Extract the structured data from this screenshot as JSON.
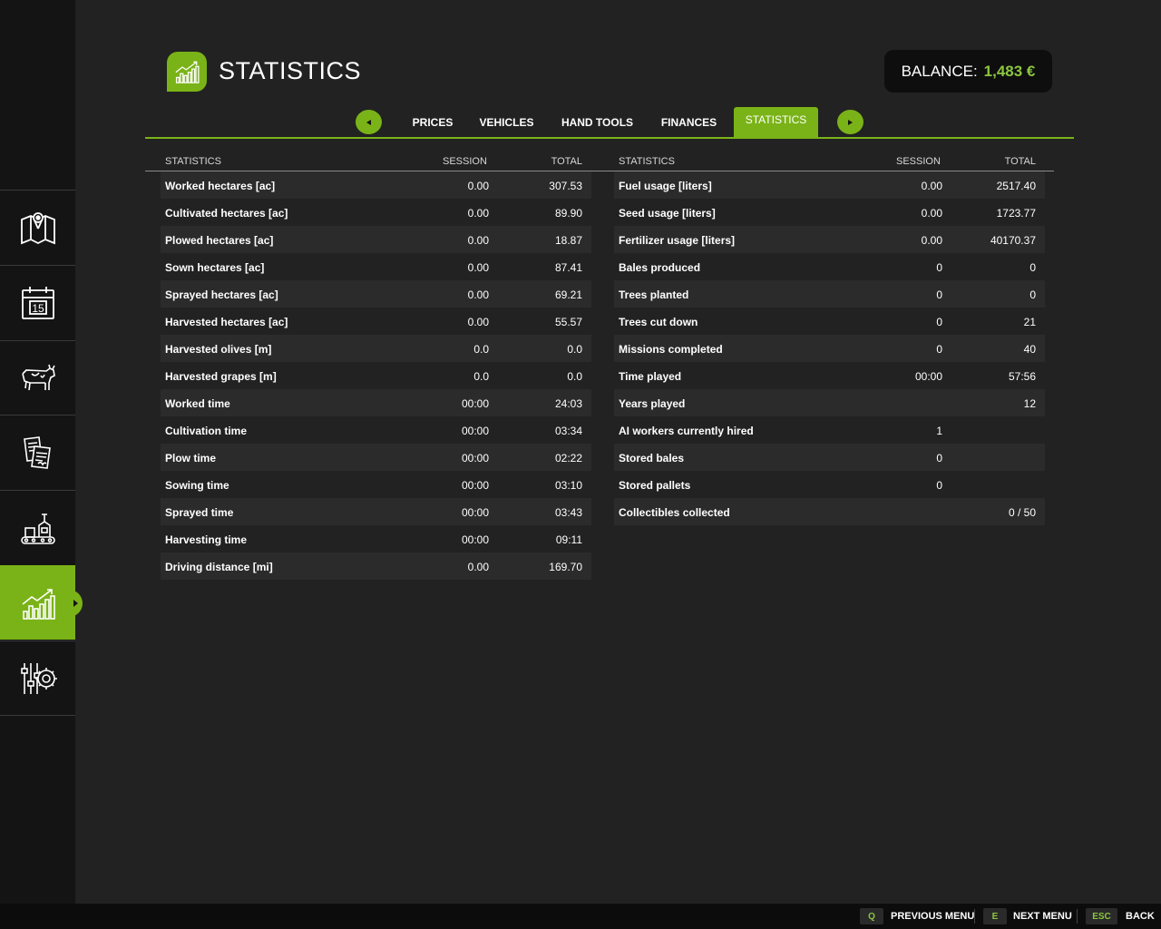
{
  "header": {
    "title": "STATISTICS",
    "balance_label": "BALANCE:",
    "balance_value": "1,483 €"
  },
  "tabs": [
    {
      "label": "PRICES"
    },
    {
      "label": "VEHICLES"
    },
    {
      "label": "HAND TOOLS"
    },
    {
      "label": "FINANCES"
    },
    {
      "label": "STATISTICS",
      "active": true
    }
  ],
  "left_table": {
    "headers": {
      "name": "STATISTICS",
      "session": "SESSION",
      "total": "TOTAL"
    },
    "rows": [
      {
        "name": "Worked hectares [ac]",
        "session": "0.00",
        "total": "307.53"
      },
      {
        "name": "Cultivated hectares [ac]",
        "session": "0.00",
        "total": "89.90"
      },
      {
        "name": "Plowed hectares [ac]",
        "session": "0.00",
        "total": "18.87"
      },
      {
        "name": "Sown hectares [ac]",
        "session": "0.00",
        "total": "87.41"
      },
      {
        "name": "Sprayed hectares [ac]",
        "session": "0.00",
        "total": "69.21"
      },
      {
        "name": "Harvested hectares [ac]",
        "session": "0.00",
        "total": "55.57"
      },
      {
        "name": "Harvested olives [m]",
        "session": "0.0",
        "total": "0.0"
      },
      {
        "name": "Harvested grapes [m]",
        "session": "0.0",
        "total": "0.0"
      },
      {
        "name": "Worked time",
        "session": "00:00",
        "total": "24:03"
      },
      {
        "name": "Cultivation time",
        "session": "00:00",
        "total": "03:34"
      },
      {
        "name": "Plow time",
        "session": "00:00",
        "total": "02:22"
      },
      {
        "name": "Sowing time",
        "session": "00:00",
        "total": "03:10"
      },
      {
        "name": "Sprayed time",
        "session": "00:00",
        "total": "03:43"
      },
      {
        "name": "Harvesting time",
        "session": "00:00",
        "total": "09:11"
      },
      {
        "name": "Driving distance [mi]",
        "session": "0.00",
        "total": "169.70"
      }
    ]
  },
  "right_table": {
    "headers": {
      "name": "STATISTICS",
      "session": "SESSION",
      "total": "TOTAL"
    },
    "rows": [
      {
        "name": "Fuel usage [liters]",
        "session": "0.00",
        "total": "2517.40"
      },
      {
        "name": "Seed usage [liters]",
        "session": "0.00",
        "total": "1723.77"
      },
      {
        "name": "Fertilizer usage [liters]",
        "session": "0.00",
        "total": "40170.37"
      },
      {
        "name": "Bales produced",
        "session": "0",
        "total": "0"
      },
      {
        "name": "Trees planted",
        "session": "0",
        "total": "0"
      },
      {
        "name": "Trees cut down",
        "session": "0",
        "total": "21"
      },
      {
        "name": "Missions completed",
        "session": "0",
        "total": "40"
      },
      {
        "name": "Time played",
        "session": "00:00",
        "total": "57:56"
      },
      {
        "name": "Years played",
        "session": "",
        "total": "12"
      },
      {
        "name": "AI workers currently hired",
        "session": "1",
        "total": ""
      },
      {
        "name": "Stored bales",
        "session": "0",
        "total": ""
      },
      {
        "name": "Stored pallets",
        "session": "0",
        "total": ""
      },
      {
        "name": "Collectibles collected",
        "session": "",
        "total": "0 / 50"
      }
    ]
  },
  "footer": {
    "prev_key": "Q",
    "prev_label": "PREVIOUS MENU",
    "next_key": "E",
    "next_label": "NEXT MENU",
    "back_key": "ESC",
    "back_label": "BACK"
  },
  "sidebar": {
    "items": [
      {
        "icon": "map-icon"
      },
      {
        "icon": "calendar-icon",
        "text": "15"
      },
      {
        "icon": "animals-icon"
      },
      {
        "icon": "contracts-icon"
      },
      {
        "icon": "production-icon"
      },
      {
        "icon": "statistics-icon",
        "active": true
      },
      {
        "icon": "settings-icon"
      }
    ]
  },
  "colors": {
    "accent": "#7ab317",
    "balance": "#8cc63f",
    "background": "#222222",
    "sidebar": "#141414"
  }
}
